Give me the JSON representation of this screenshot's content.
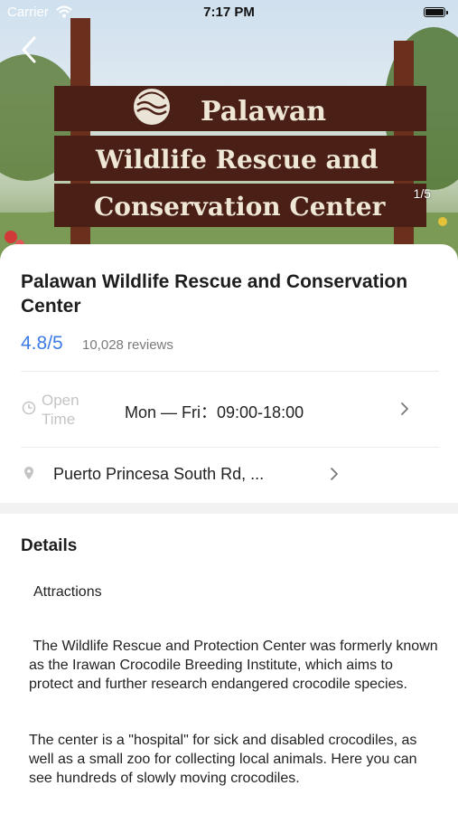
{
  "status_bar": {
    "carrier": "Carrier",
    "time": "7:17 PM"
  },
  "hero": {
    "sign_lines": [
      "Palawan",
      "Wildlife Rescue and",
      "Conservation Center"
    ],
    "photo_counter": "1/5"
  },
  "place": {
    "name": "Palawan Wildlife Rescue and Conservation Center",
    "rating": "4.8/5",
    "reviews": "10,028 reviews",
    "rating_color": "#3d7ce6"
  },
  "open_time": {
    "label": "Open Time",
    "hours": "Mon — Fri：09:00-18:00"
  },
  "location": {
    "address": "Puerto Princesa South Rd, ..."
  },
  "details": {
    "title": "Details",
    "section_label": "Attractions",
    "paragraphs": [
      " The Wildlife Rescue and Protection Center was formerly known as the Irawan Crocodile Breeding Institute, which aims to protect and further research endangered crocodile species.",
      "The center is a \"hospital\" for sick and disabled crocodiles, as well as a small zoo for collecting local animals. Here you can see hundreds of slowly moving crocodiles."
    ]
  },
  "icons": {
    "back": "chevron-left-icon",
    "wifi": "wifi-icon",
    "battery": "battery-icon",
    "clock": "clock-icon",
    "location": "location-pin-icon",
    "row_arrow": "chevron-right-icon"
  }
}
